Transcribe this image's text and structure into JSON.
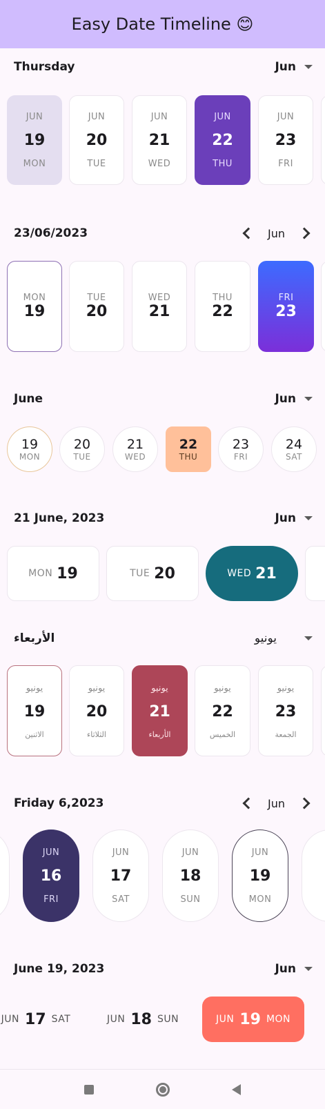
{
  "appbar": {
    "title": "Easy Date Timeline 😊"
  },
  "s1": {
    "title": "Thursday",
    "month": "Jun",
    "items": [
      {
        "m": "JUN",
        "d": "19",
        "w": "MON"
      },
      {
        "m": "JUN",
        "d": "20",
        "w": "TUE"
      },
      {
        "m": "JUN",
        "d": "21",
        "w": "WED"
      },
      {
        "m": "JUN",
        "d": "22",
        "w": "THU"
      },
      {
        "m": "JUN",
        "d": "23",
        "w": "FRI"
      }
    ]
  },
  "s2": {
    "title": "23/06/2023",
    "month": "Jun",
    "items": [
      {
        "w": "MON",
        "d": "19"
      },
      {
        "w": "TUE",
        "d": "20"
      },
      {
        "w": "WED",
        "d": "21"
      },
      {
        "w": "THU",
        "d": "22"
      },
      {
        "w": "FRI",
        "d": "23"
      }
    ]
  },
  "s3": {
    "title": "June",
    "month": "Jun",
    "items": [
      {
        "d": "19",
        "w": "MON"
      },
      {
        "d": "20",
        "w": "TUE"
      },
      {
        "d": "21",
        "w": "WED"
      },
      {
        "d": "22",
        "w": "THU"
      },
      {
        "d": "23",
        "w": "FRI"
      },
      {
        "d": "24",
        "w": "SAT"
      }
    ]
  },
  "s4": {
    "title": "21 June, 2023",
    "month": "Jun",
    "items": [
      {
        "w": "MON",
        "d": "19"
      },
      {
        "w": "TUE",
        "d": "20"
      },
      {
        "w": "WED",
        "d": "21"
      }
    ]
  },
  "s5": {
    "title": "الأربعاء",
    "month": "يونيو",
    "items": [
      {
        "m": "يونيو",
        "d": "19",
        "w": "الاثنين"
      },
      {
        "m": "يونيو",
        "d": "20",
        "w": "الثلاثاء"
      },
      {
        "m": "يونيو",
        "d": "21",
        "w": "الأربعاء"
      },
      {
        "m": "يونيو",
        "d": "22",
        "w": "الخميس"
      },
      {
        "m": "يونيو",
        "d": "23",
        "w": "الجمعة"
      }
    ]
  },
  "s6": {
    "title": "Friday 6,2023",
    "month": "Jun",
    "items": [
      {
        "m": "JUN",
        "d": "16",
        "w": "FRI"
      },
      {
        "m": "JUN",
        "d": "17",
        "w": "SAT"
      },
      {
        "m": "JUN",
        "d": "18",
        "w": "SUN"
      },
      {
        "m": "JUN",
        "d": "19",
        "w": "MON"
      }
    ]
  },
  "s7": {
    "title": "June 19, 2023",
    "month": "Jun",
    "items": [
      {
        "m": "JUN",
        "d": "17",
        "w": "SAT"
      },
      {
        "m": "JUN",
        "d": "18",
        "w": "SUN"
      },
      {
        "m": "JUN",
        "d": "19",
        "w": "MON"
      }
    ]
  },
  "colors": {
    "appbar": "#d0bcfe",
    "s1_selected": "#6b3fba",
    "s2_gradient_start": "#3d6bff",
    "s2_gradient_end": "#7b2fd9",
    "s3_selected": "#ffc09a",
    "s4_selected": "#166c7d",
    "s5_selected": "#ad4658",
    "s6_selected": "#3b3368",
    "s7_selected": "#ff6f61"
  }
}
